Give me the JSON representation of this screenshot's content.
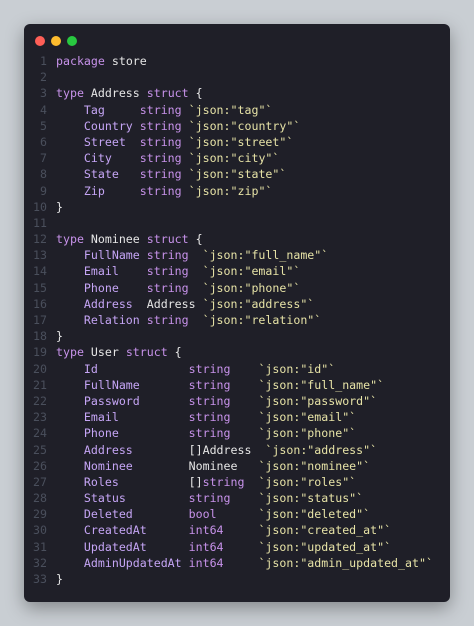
{
  "window": {
    "controls": [
      "close",
      "minimize",
      "maximize"
    ]
  },
  "code": {
    "lines": [
      {
        "n": "1",
        "tokens": [
          {
            "t": "package",
            "c": "kw"
          },
          {
            "t": " store",
            "c": "id"
          }
        ]
      },
      {
        "n": "2",
        "tokens": []
      },
      {
        "n": "3",
        "tokens": [
          {
            "t": "type",
            "c": "kw"
          },
          {
            "t": " Address ",
            "c": "id"
          },
          {
            "t": "struct",
            "c": "kw"
          },
          {
            "t": " {",
            "c": "punc"
          }
        ]
      },
      {
        "n": "4",
        "tokens": [
          {
            "t": "    Tag     ",
            "c": "field"
          },
          {
            "t": "string ",
            "c": "type"
          },
          {
            "t": "`json:\"tag\"`",
            "c": "tag"
          }
        ]
      },
      {
        "n": "5",
        "tokens": [
          {
            "t": "    Country ",
            "c": "field"
          },
          {
            "t": "string ",
            "c": "type"
          },
          {
            "t": "`json:\"country\"`",
            "c": "tag"
          }
        ]
      },
      {
        "n": "6",
        "tokens": [
          {
            "t": "    Street  ",
            "c": "field"
          },
          {
            "t": "string ",
            "c": "type"
          },
          {
            "t": "`json:\"street\"`",
            "c": "tag"
          }
        ]
      },
      {
        "n": "7",
        "tokens": [
          {
            "t": "    City    ",
            "c": "field"
          },
          {
            "t": "string ",
            "c": "type"
          },
          {
            "t": "`json:\"city\"`",
            "c": "tag"
          }
        ]
      },
      {
        "n": "8",
        "tokens": [
          {
            "t": "    State   ",
            "c": "field"
          },
          {
            "t": "string ",
            "c": "type"
          },
          {
            "t": "`json:\"state\"`",
            "c": "tag"
          }
        ]
      },
      {
        "n": "9",
        "tokens": [
          {
            "t": "    Zip     ",
            "c": "field"
          },
          {
            "t": "string ",
            "c": "type"
          },
          {
            "t": "`json:\"zip\"`",
            "c": "tag"
          }
        ]
      },
      {
        "n": "10",
        "tokens": [
          {
            "t": "}",
            "c": "punc"
          }
        ]
      },
      {
        "n": "11",
        "tokens": []
      },
      {
        "n": "12",
        "tokens": [
          {
            "t": "type",
            "c": "kw"
          },
          {
            "t": " Nominee ",
            "c": "id"
          },
          {
            "t": "struct",
            "c": "kw"
          },
          {
            "t": " {",
            "c": "punc"
          }
        ]
      },
      {
        "n": "13",
        "tokens": [
          {
            "t": "    FullName ",
            "c": "field"
          },
          {
            "t": "string  ",
            "c": "type"
          },
          {
            "t": "`json:\"full_name\"`",
            "c": "tag"
          }
        ]
      },
      {
        "n": "14",
        "tokens": [
          {
            "t": "    Email    ",
            "c": "field"
          },
          {
            "t": "string  ",
            "c": "type"
          },
          {
            "t": "`json:\"email\"`",
            "c": "tag"
          }
        ]
      },
      {
        "n": "15",
        "tokens": [
          {
            "t": "    Phone    ",
            "c": "field"
          },
          {
            "t": "string  ",
            "c": "type"
          },
          {
            "t": "`json:\"phone\"`",
            "c": "tag"
          }
        ]
      },
      {
        "n": "16",
        "tokens": [
          {
            "t": "    Address  ",
            "c": "field"
          },
          {
            "t": "Address ",
            "c": "id"
          },
          {
            "t": "`json:\"address\"`",
            "c": "tag"
          }
        ]
      },
      {
        "n": "17",
        "tokens": [
          {
            "t": "    Relation ",
            "c": "field"
          },
          {
            "t": "string  ",
            "c": "type"
          },
          {
            "t": "`json:\"relation\"`",
            "c": "tag"
          }
        ]
      },
      {
        "n": "18",
        "tokens": [
          {
            "t": "}",
            "c": "punc"
          }
        ]
      },
      {
        "n": "19",
        "tokens": [
          {
            "t": "type",
            "c": "kw"
          },
          {
            "t": " User ",
            "c": "id"
          },
          {
            "t": "struct",
            "c": "kw"
          },
          {
            "t": " {",
            "c": "punc"
          }
        ]
      },
      {
        "n": "20",
        "tokens": [
          {
            "t": "    Id             ",
            "c": "field"
          },
          {
            "t": "string    ",
            "c": "type"
          },
          {
            "t": "`json:\"id\"`",
            "c": "tag"
          }
        ]
      },
      {
        "n": "21",
        "tokens": [
          {
            "t": "    FullName       ",
            "c": "field"
          },
          {
            "t": "string    ",
            "c": "type"
          },
          {
            "t": "`json:\"full_name\"`",
            "c": "tag"
          }
        ]
      },
      {
        "n": "22",
        "tokens": [
          {
            "t": "    Password       ",
            "c": "field"
          },
          {
            "t": "string    ",
            "c": "type"
          },
          {
            "t": "`json:\"password\"`",
            "c": "tag"
          }
        ]
      },
      {
        "n": "23",
        "tokens": [
          {
            "t": "    Email          ",
            "c": "field"
          },
          {
            "t": "string    ",
            "c": "type"
          },
          {
            "t": "`json:\"email\"`",
            "c": "tag"
          }
        ]
      },
      {
        "n": "24",
        "tokens": [
          {
            "t": "    Phone          ",
            "c": "field"
          },
          {
            "t": "string    ",
            "c": "type"
          },
          {
            "t": "`json:\"phone\"`",
            "c": "tag"
          }
        ]
      },
      {
        "n": "25",
        "tokens": [
          {
            "t": "    Address        ",
            "c": "field"
          },
          {
            "t": "[]",
            "c": "punc"
          },
          {
            "t": "Address  ",
            "c": "id"
          },
          {
            "t": "`json:\"address\"`",
            "c": "tag"
          }
        ]
      },
      {
        "n": "26",
        "tokens": [
          {
            "t": "    Nominee        ",
            "c": "field"
          },
          {
            "t": "Nominee   ",
            "c": "id"
          },
          {
            "t": "`json:\"nominee\"`",
            "c": "tag"
          }
        ]
      },
      {
        "n": "27",
        "tokens": [
          {
            "t": "    Roles          ",
            "c": "field"
          },
          {
            "t": "[]",
            "c": "punc"
          },
          {
            "t": "string  ",
            "c": "type"
          },
          {
            "t": "`json:\"roles\"`",
            "c": "tag"
          }
        ]
      },
      {
        "n": "28",
        "tokens": [
          {
            "t": "    Status         ",
            "c": "field"
          },
          {
            "t": "string    ",
            "c": "type"
          },
          {
            "t": "`json:\"status\"`",
            "c": "tag"
          }
        ]
      },
      {
        "n": "29",
        "tokens": [
          {
            "t": "    Deleted        ",
            "c": "field"
          },
          {
            "t": "bool      ",
            "c": "type"
          },
          {
            "t": "`json:\"deleted\"`",
            "c": "tag"
          }
        ]
      },
      {
        "n": "30",
        "tokens": [
          {
            "t": "    CreatedAt      ",
            "c": "field"
          },
          {
            "t": "int64     ",
            "c": "type"
          },
          {
            "t": "`json:\"created_at\"`",
            "c": "tag"
          }
        ]
      },
      {
        "n": "31",
        "tokens": [
          {
            "t": "    UpdatedAt      ",
            "c": "field"
          },
          {
            "t": "int64     ",
            "c": "type"
          },
          {
            "t": "`json:\"updated_at\"`",
            "c": "tag"
          }
        ]
      },
      {
        "n": "32",
        "tokens": [
          {
            "t": "    AdminUpdatedAt ",
            "c": "field"
          },
          {
            "t": "int64     ",
            "c": "type"
          },
          {
            "t": "`json:\"admin_updated_at\"`",
            "c": "tag"
          }
        ]
      },
      {
        "n": "33",
        "tokens": [
          {
            "t": "}",
            "c": "punc"
          }
        ]
      }
    ]
  },
  "colors": {
    "background": "#c9ced3",
    "editor": "#1f1f28",
    "keyword": "#c792ea",
    "tag": "#e6e2a6",
    "line_number": "#4a4f5c"
  }
}
